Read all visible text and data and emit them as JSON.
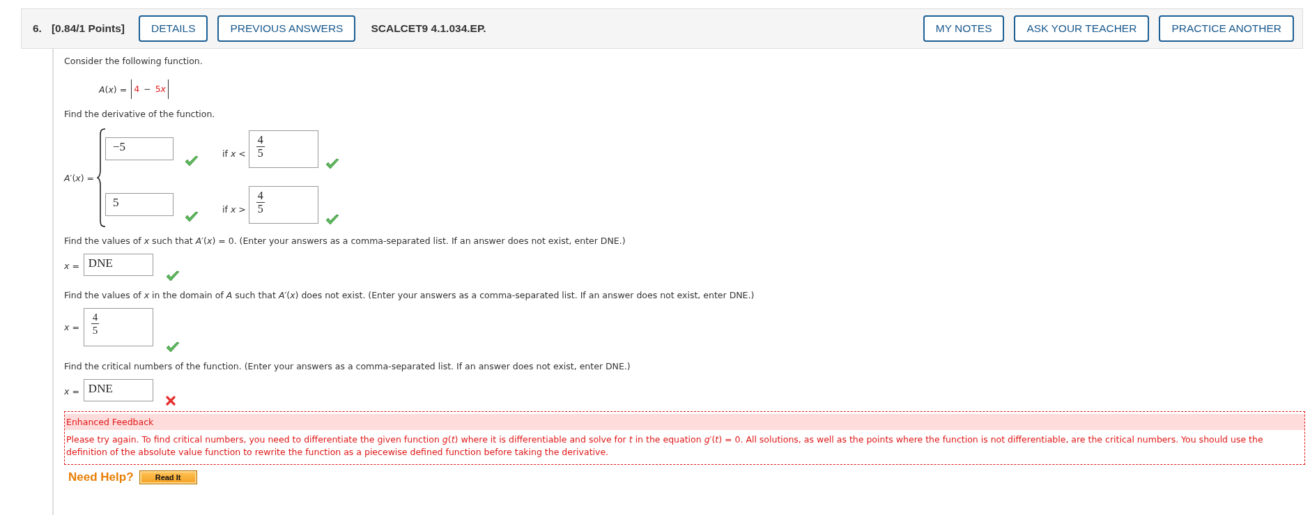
{
  "header": {
    "number": "6.",
    "points": "[0.84/1 Points]",
    "left_buttons": [
      "DETAILS",
      "PREVIOUS ANSWERS"
    ],
    "code": "SCALCET9 4.1.034.EP.",
    "right_buttons": [
      "MY NOTES",
      "ASK YOUR TEACHER",
      "PRACTICE ANOTHER"
    ]
  },
  "intro": "Consider the following function.",
  "function": {
    "lhs": "*A*(*x*) =",
    "terms": [
      {
        "text": "4",
        "kind": "given"
      },
      {
        "text": "−",
        "kind": "operator"
      },
      {
        "text": "5",
        "kind": "given"
      },
      {
        "text": "*x*",
        "kind": "given"
      }
    ]
  },
  "derivative": {
    "prompt": "Find the derivative of the function.",
    "lhs": "*A*′(*x*) =",
    "cases": [
      {
        "value": "−5",
        "value_correct": true,
        "condition": "if *x* <",
        "bound": {
          "numerator": "4",
          "denominator": "5"
        },
        "bound_correct": true
      },
      {
        "value": "5",
        "value_correct": true,
        "condition": "if *x* >",
        "bound": {
          "numerator": "4",
          "denominator": "5"
        },
        "bound_correct": true
      }
    ]
  },
  "questions": [
    {
      "prompt": "Find the values of *x* such that *A*′(*x*) = 0. (Enter your answers as a comma-separated list. If an answer does not exist, enter DNE.)",
      "label": "*x* =",
      "answer": {
        "kind": "text",
        "value": "DNE"
      },
      "correct": true
    },
    {
      "prompt": "Find the values of *x* in the domain of *A* such that *A*′(*x*) does not exist. (Enter your answers as a comma-separated list. If an answer does not exist, enter DNE.)",
      "label": "*x* =",
      "answer": {
        "kind": "fraction",
        "numerator": "4",
        "denominator": "5"
      },
      "correct": true
    },
    {
      "prompt": "Find the critical numbers of the function. (Enter your answers as a comma-separated list. If an answer does not exist, enter DNE.)",
      "label": "*x* =",
      "answer": {
        "kind": "text",
        "value": "DNE"
      },
      "correct": false
    }
  ],
  "feedback": {
    "title": "Enhanced Feedback",
    "text": "Please try again. To find critical numbers, you need to differentiate the given function *g*(*t*) where it is differentiable and solve for *t* in the equation *g*′(*t*) = 0. All solutions, as well as the points where the function is not differentiable, are the critical numbers. You should use the definition of the absolute value function to rewrite the function as a piecewise defined function before taking the derivative."
  },
  "help": {
    "label": "Need Help?",
    "button": "Read It"
  }
}
